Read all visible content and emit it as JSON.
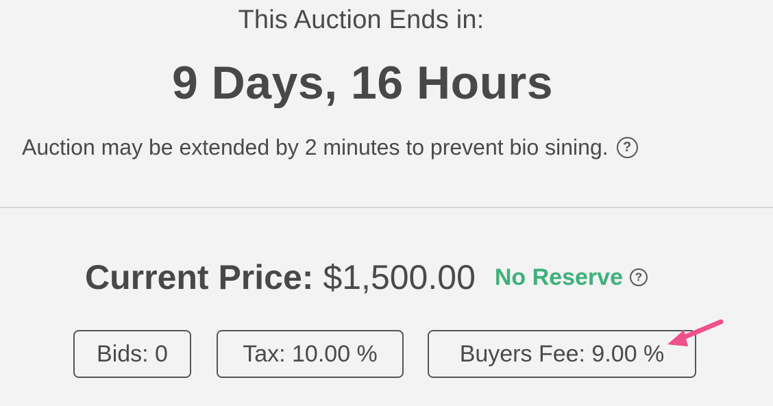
{
  "auction": {
    "ends_label": "This Auction Ends in:",
    "countdown": "9 Days, 16 Hours",
    "extend_note": "Auction may be extended by 2 minutes to prevent bio sining.",
    "help_icon_glyph": "?"
  },
  "pricing": {
    "price_label": "Current Price:",
    "price_value": "$1,500.00",
    "reserve_label": "No Reserve",
    "reserve_color": "#3fb07a"
  },
  "stats": {
    "bids": "Bids: 0",
    "tax": "Tax: 10.00 %",
    "buyers_fee": "Buyers Fee: 9.00 %"
  },
  "annotation": {
    "arrow_color": "#f0508c",
    "arrow_icon": "pointer-arrow-icon"
  }
}
